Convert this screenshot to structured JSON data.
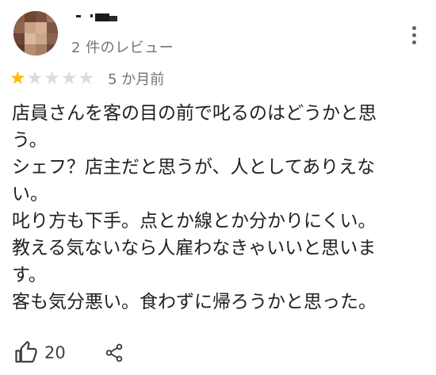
{
  "reviewer": {
    "meta": "2 件のレビュー"
  },
  "rating": {
    "value": 1,
    "max": 5,
    "date": "5 か月前"
  },
  "review": {
    "text": "店員さんを客の目の前で叱るのはどうかと思う。\nシェフ？店主だと思うが、人としてありえない。\n叱り方も下手。点とか線とか分かりにくい。\n教える気ないなら人雇わなきゃいいと思います。\n客も気分悪い。食わずに帰ろうかと思った。"
  },
  "actions": {
    "like_count": "20"
  },
  "icons": {
    "like": "thumb-up-icon",
    "share": "share-icon",
    "more": "more-vert-icon"
  },
  "colors": {
    "star_filled": "#fbbc04",
    "star_empty": "#dadce0",
    "meta_text": "#70757a"
  }
}
